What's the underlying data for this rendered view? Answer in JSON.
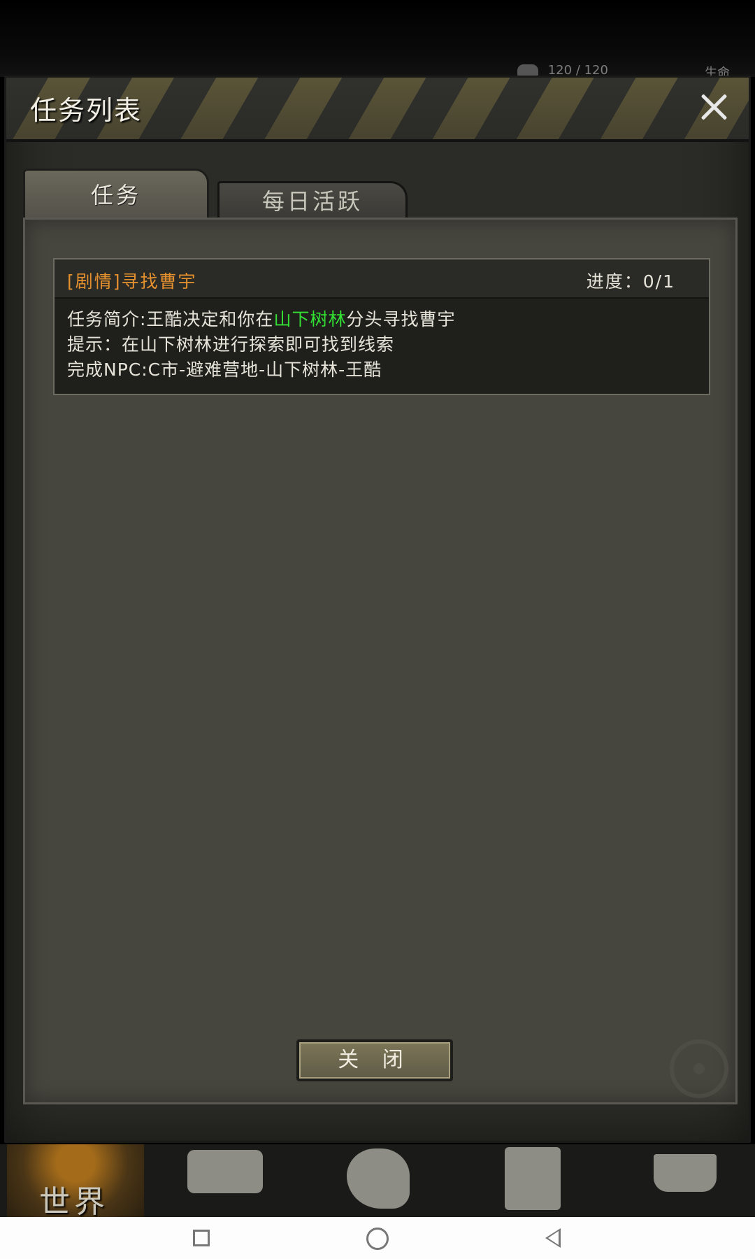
{
  "hud": {
    "hp": "120 / 120",
    "life": "生命"
  },
  "dialog": {
    "title": "任务列表",
    "tabs": [
      {
        "label": "任务",
        "active": true
      },
      {
        "label": "每日活跃",
        "active": false
      }
    ],
    "task": {
      "name": "[剧情]寻找曹宇",
      "progress": "进度：0/1",
      "intro_prefix": "任务简介:王酷决定和你在",
      "intro_highlight": "山下树林",
      "intro_suffix": "分头寻找曹宇",
      "hint": "提示：在山下树林进行探索即可找到线索",
      "npc": "完成NPC:C市-避难营地-山下树林-王酷"
    },
    "close_button": "关 闭"
  },
  "bottom_nav": {
    "items": [
      {
        "label": "世界",
        "icon": "globe-icon"
      },
      {
        "icon": "backpack-icon"
      },
      {
        "icon": "head-skill-icon"
      },
      {
        "icon": "building-icon"
      },
      {
        "icon": "cart-icon"
      }
    ]
  },
  "colors": {
    "accent_orange": "#e4902f",
    "highlight_green": "#33e033",
    "panel": "#46453e"
  }
}
